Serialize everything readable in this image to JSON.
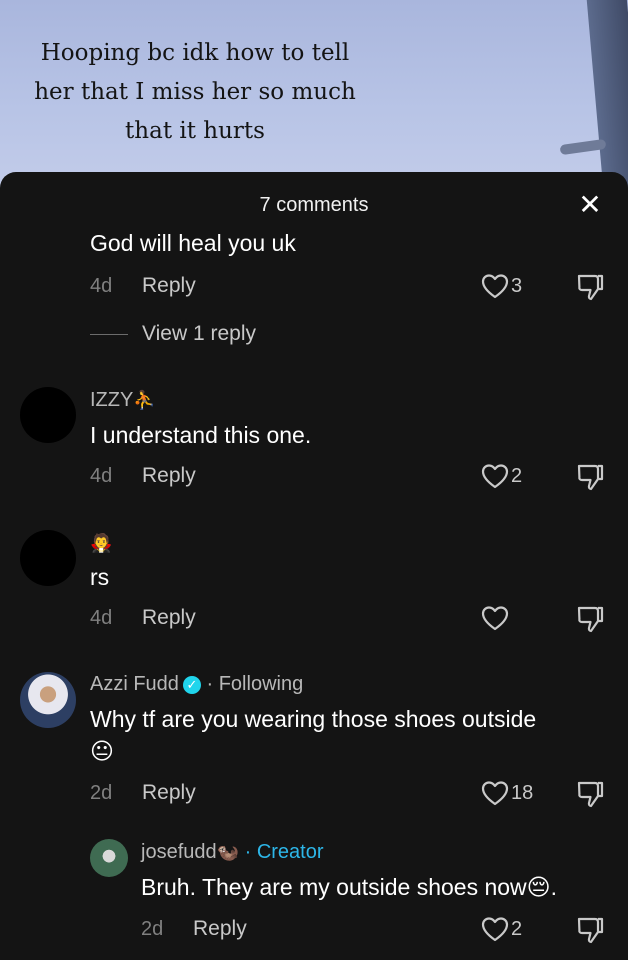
{
  "video": {
    "caption": "Hooping bc idk how to tell her that I miss her so much that it hurts"
  },
  "sheet": {
    "title": "7 comments",
    "close_label": "✕"
  },
  "reply_label": "Reply",
  "comments": [
    {
      "text": "God will heal you uk",
      "time": "4d",
      "likes": "3",
      "view_replies": "View 1 reply"
    },
    {
      "username": "IZZY",
      "username_emoji": "⛹",
      "text": "I understand this one.",
      "time": "4d",
      "likes": "2"
    },
    {
      "username_emoji": "🧛",
      "text": "rs",
      "time": "4d",
      "likes": ""
    },
    {
      "username": "Azzi Fudd",
      "following": "· Following",
      "text_line1": "Why tf are you wearing those shoes outside",
      "text_line2": "😐",
      "time": "2d",
      "likes": "18"
    },
    {
      "username": "josefudd",
      "username_emoji": "🦦",
      "creator": "· Creator",
      "text": "Bruh. They are my outside shoes now😔.",
      "time": "2d",
      "likes": "2"
    }
  ],
  "colors": {
    "sheet_bg": "#141414",
    "accent_creator": "#2db6e8",
    "verified": "#20d5ec"
  },
  "icons": [
    "close-icon",
    "heart-icon",
    "dislike-icon",
    "verified-icon"
  ]
}
